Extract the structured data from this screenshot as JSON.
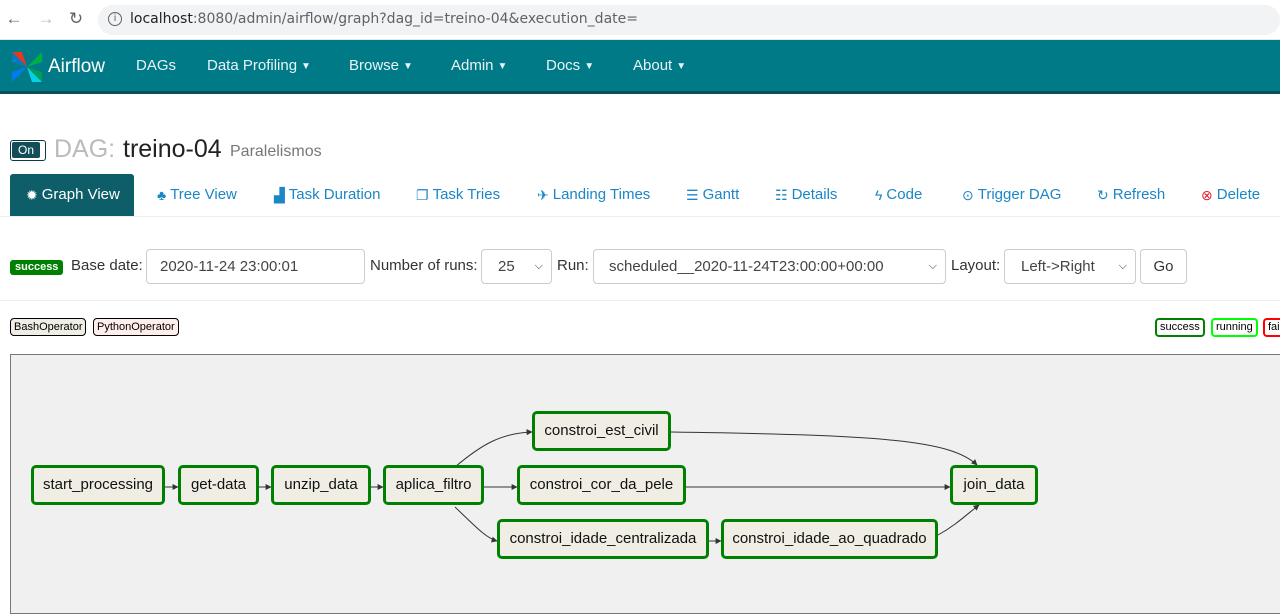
{
  "browser": {
    "url_host": "localhost",
    "url_path": ":8080/admin/airflow/graph?dag_id=treino-04&execution_date="
  },
  "navbar": {
    "brand": "Airflow",
    "items": [
      {
        "label": "DAGs",
        "dropdown": false
      },
      {
        "label": "Data Profiling",
        "dropdown": true
      },
      {
        "label": "Browse",
        "dropdown": true
      },
      {
        "label": "Admin",
        "dropdown": true
      },
      {
        "label": "Docs",
        "dropdown": true
      },
      {
        "label": "About",
        "dropdown": true
      }
    ]
  },
  "header": {
    "toggle": "On",
    "dag_label": "DAG:",
    "dag_id": "treino-04",
    "description": "Paralelismos"
  },
  "tabs": [
    {
      "label": "Graph View",
      "icon": "certificate-icon",
      "active": true
    },
    {
      "label": "Tree View",
      "icon": "tree-icon"
    },
    {
      "label": "Task Duration",
      "icon": "bar-chart-icon"
    },
    {
      "label": "Task Tries",
      "icon": "duplicate-icon"
    },
    {
      "label": "Landing Times",
      "icon": "plane-icon"
    },
    {
      "label": "Gantt",
      "icon": "align-left-icon"
    },
    {
      "label": "Details",
      "icon": "list-icon"
    },
    {
      "label": "Code",
      "icon": "flash-icon"
    },
    {
      "label": "Trigger DAG",
      "icon": "play-circle-icon"
    },
    {
      "label": "Refresh",
      "icon": "refresh-icon"
    },
    {
      "label": "Delete",
      "icon": "remove-circle-icon"
    }
  ],
  "controls": {
    "state_badge": "success",
    "base_date_label": "Base date:",
    "base_date": "2020-11-24 23:00:01",
    "num_runs_label": "Number of runs:",
    "num_runs": "25",
    "run_label": "Run:",
    "run": "scheduled__2020-11-24T23:00:00+00:00",
    "layout_label": "Layout:",
    "layout": "Left->Right",
    "go": "Go"
  },
  "operators": [
    "BashOperator",
    "PythonOperator"
  ],
  "states": [
    {
      "label": "success",
      "color": "#008000"
    },
    {
      "label": "running",
      "color": "#00ff00"
    },
    {
      "label": "fai",
      "color": "#ff0000"
    }
  ],
  "colors": {
    "navbar": "#007a87",
    "node_border": "#008000",
    "node_fill": "#f0ede4",
    "bash_operator": "#f0ede4",
    "python_operator": "#ffefeb"
  },
  "graph": {
    "nodes": [
      {
        "id": "start_processing"
      },
      {
        "id": "get-data"
      },
      {
        "id": "unzip_data"
      },
      {
        "id": "aplica_filtro"
      },
      {
        "id": "constroi_est_civil"
      },
      {
        "id": "constroi_cor_da_pele"
      },
      {
        "id": "constroi_idade_centralizada"
      },
      {
        "id": "constroi_idade_ao_quadrado"
      },
      {
        "id": "join_data"
      }
    ]
  }
}
